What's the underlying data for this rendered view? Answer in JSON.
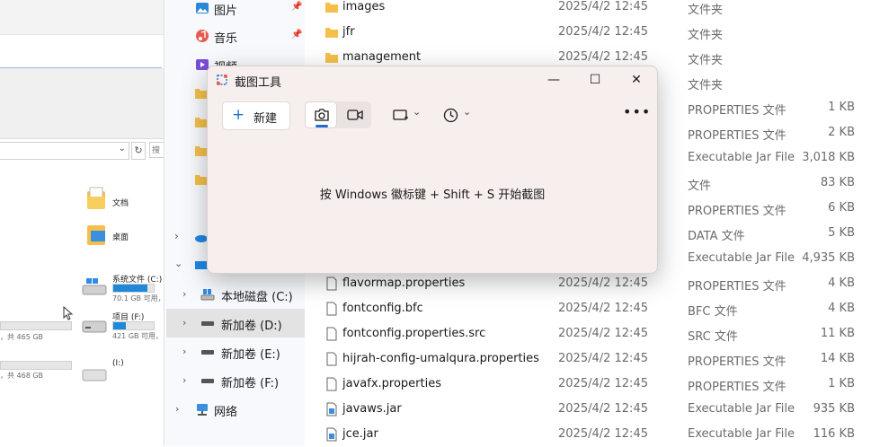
{
  "background_window": {
    "quick_access": [
      {
        "label": "文档"
      },
      {
        "label": "桌面"
      }
    ],
    "drives": [
      {
        "name": "系统文件 (C:)",
        "sub": "70.1 GB 可用，",
        "usage": 0.85
      },
      {
        "name": "项目 (F:)",
        "sub": "421 GB 可用，",
        "usage": 0.3
      },
      {
        "name": "(I:)",
        "sub": "",
        "usage": 0
      }
    ],
    "left_texts": [
      "，共 465 GB",
      "，共 468 GB"
    ],
    "search_partial": "搜"
  },
  "nav": {
    "items": [
      {
        "label": "图片",
        "icon": "pictures-icon",
        "pinned": true
      },
      {
        "label": "音乐",
        "icon": "music-icon",
        "pinned": true
      },
      {
        "label": "视频",
        "icon": "videos-icon",
        "pinned": false
      },
      {
        "label": "本地磁盘 (C:)",
        "icon": "windows-drive-icon",
        "expandable": true
      },
      {
        "label": "新加卷 (D:)",
        "icon": "drive-icon",
        "expandable": true,
        "selected": true
      },
      {
        "label": "新加卷 (E:)",
        "icon": "drive-icon",
        "expandable": true
      },
      {
        "label": "新加卷 (F:)",
        "icon": "drive-icon",
        "expandable": true
      },
      {
        "label": "网络",
        "icon": "network-icon",
        "expandable": true
      }
    ]
  },
  "files": [
    {
      "name": "images",
      "date": "2025/4/2 12:45",
      "type": "文件夹",
      "size": "",
      "icon": "folder-icon"
    },
    {
      "name": "jfr",
      "date": "2025/4/2 12:45",
      "type": "文件夹",
      "size": "",
      "icon": "folder-icon"
    },
    {
      "name": "management",
      "date": "2025/4/2 12:45",
      "type": "文件夹",
      "size": "",
      "icon": "folder-icon"
    },
    {
      "name": "",
      "date": "",
      "type": "文件夹",
      "size": "",
      "icon": ""
    },
    {
      "name": "",
      "date": "",
      "type": "PROPERTIES 文件",
      "size": "1 KB",
      "icon": ""
    },
    {
      "name": "",
      "date": "",
      "type": "PROPERTIES 文件",
      "size": "2 KB",
      "icon": ""
    },
    {
      "name": "",
      "date": "",
      "type": "Executable Jar File",
      "size": "3,018 KB",
      "icon": ""
    },
    {
      "name": "",
      "date": "",
      "type": "文件",
      "size": "83 KB",
      "icon": ""
    },
    {
      "name": "",
      "date": "",
      "type": "PROPERTIES 文件",
      "size": "6 KB",
      "icon": ""
    },
    {
      "name": "",
      "date": "",
      "type": "DATA 文件",
      "size": "5 KB",
      "icon": ""
    },
    {
      "name": "",
      "date": "",
      "type": "Executable Jar File",
      "size": "4,935 KB",
      "icon": ""
    },
    {
      "name": "flavormap.properties",
      "date": "2025/4/2 12:45",
      "type": "PROPERTIES 文件",
      "size": "4 KB",
      "icon": "file-icon"
    },
    {
      "name": "fontconfig.bfc",
      "date": "2025/4/2 12:45",
      "type": "BFC 文件",
      "size": "4 KB",
      "icon": "file-icon"
    },
    {
      "name": "fontconfig.properties.src",
      "date": "2025/4/2 12:45",
      "type": "SRC 文件",
      "size": "11 KB",
      "icon": "file-icon"
    },
    {
      "name": "hijrah-config-umalqura.properties",
      "date": "2025/4/2 12:45",
      "type": "PROPERTIES 文件",
      "size": "14 KB",
      "icon": "file-icon"
    },
    {
      "name": "javafx.properties",
      "date": "2025/4/2 12:45",
      "type": "PROPERTIES 文件",
      "size": "1 KB",
      "icon": "file-icon"
    },
    {
      "name": "javaws.jar",
      "date": "2025/4/2 12:45",
      "type": "Executable Jar File",
      "size": "935 KB",
      "icon": "jar-icon"
    },
    {
      "name": "jce.jar",
      "date": "2025/4/2 12:45",
      "type": "Executable Jar File",
      "size": "116 KB",
      "icon": "jar-icon"
    }
  ],
  "snipping_tool": {
    "title": "截图工具",
    "new_label": "新建",
    "message": "按 Windows 徽标键 + Shift + S 开始截图",
    "window_buttons": {
      "minimize": "—",
      "maximize": "☐",
      "close": "✕"
    }
  },
  "colors": {
    "accent": "#1f6fd0",
    "folder": "#f5c04a",
    "selected_nav": "#e3e3e3"
  }
}
